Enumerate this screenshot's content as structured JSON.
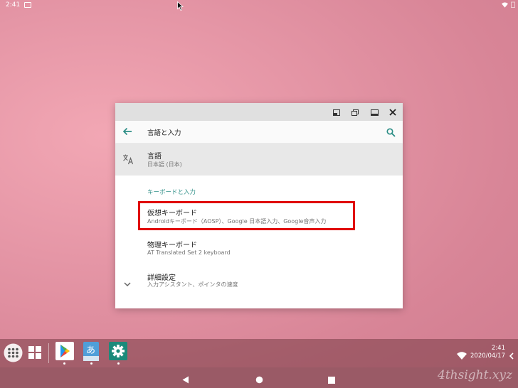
{
  "status": {
    "time": "2:41"
  },
  "window": {
    "appbar_title": "言語と入力"
  },
  "settings": {
    "language": {
      "title": "言語",
      "subtitle": "日本語 (日本)"
    },
    "section_header": "キーボードと入力",
    "virtual_keyboard": {
      "title": "仮想キーボード",
      "subtitle": "Androidキーボード（AOSP）、Google 日本語入力、Google音声入力"
    },
    "physical_keyboard": {
      "title": "物理キーボード",
      "subtitle": "AT Translated Set 2 keyboard"
    },
    "advanced": {
      "title": "詳細設定",
      "subtitle": "入力アシスタント、ポインタの速度"
    }
  },
  "taskbar": {
    "clock_time": "2:41",
    "clock_date": "2020/04/17",
    "ime_glyph": "あ"
  },
  "watermark": "4thsight.xyz",
  "colors": {
    "accent": "#2e8f87",
    "highlight": "#e00000"
  }
}
